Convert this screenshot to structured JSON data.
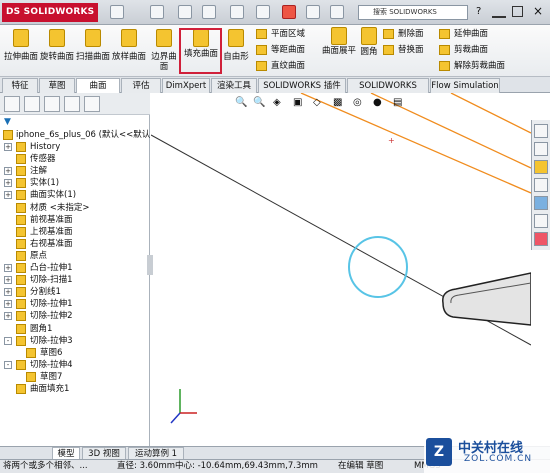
{
  "app": {
    "logo": "DS SOLIDWORKS",
    "search_placeholder": "搜索 SOLIDWORKS"
  },
  "ribbon": {
    "big": [
      "拉伸曲面",
      "旋转曲面",
      "扫描曲面",
      "放样曲面",
      "边界曲面",
      "填充曲面",
      "自由形"
    ],
    "col1": [
      "平面区域",
      "等距曲面",
      "直纹曲面"
    ],
    "mid": [
      "曲面展平",
      "圆角"
    ],
    "col2": [
      "删除面",
      "替换面"
    ],
    "col3": [
      "延伸曲面",
      "剪裁曲面",
      "解除剪裁曲面"
    ],
    "highlight": "填充曲面"
  },
  "tabs": [
    "特征",
    "草图",
    "曲面",
    "评估",
    "DimXpert",
    "渲染工具",
    "SOLIDWORKS 插件",
    "SOLIDWORKS MBD",
    "Flow Simulation"
  ],
  "active_tab": "曲面",
  "tree": {
    "filter_icon": "filter-icon",
    "root": "iphone_6s_plus_06 (默认<<默认",
    "items": [
      {
        "label": "History",
        "lvl": 1,
        "ex": "+"
      },
      {
        "label": "传感器",
        "lvl": 1,
        "ex": ""
      },
      {
        "label": "注解",
        "lvl": 1,
        "ex": "+"
      },
      {
        "label": "实体(1)",
        "lvl": 1,
        "ex": "+"
      },
      {
        "label": "曲面实体(1)",
        "lvl": 1,
        "ex": "+"
      },
      {
        "label": "材质 <未指定>",
        "lvl": 1,
        "ex": ""
      },
      {
        "label": "前视基准面",
        "lvl": 1,
        "ex": ""
      },
      {
        "label": "上视基准面",
        "lvl": 1,
        "ex": ""
      },
      {
        "label": "右视基准面",
        "lvl": 1,
        "ex": ""
      },
      {
        "label": "原点",
        "lvl": 1,
        "ex": ""
      },
      {
        "label": "凸台-拉伸1",
        "lvl": 1,
        "ex": "+"
      },
      {
        "label": "切除-扫描1",
        "lvl": 1,
        "ex": "+"
      },
      {
        "label": "分割线1",
        "lvl": 1,
        "ex": "+"
      },
      {
        "label": "切除-拉伸1",
        "lvl": 1,
        "ex": "+"
      },
      {
        "label": "切除-拉伸2",
        "lvl": 1,
        "ex": "+"
      },
      {
        "label": "圆角1",
        "lvl": 1,
        "ex": ""
      },
      {
        "label": "切除-拉伸3",
        "lvl": 1,
        "ex": "-"
      },
      {
        "label": "草图6",
        "lvl": 2,
        "ex": ""
      },
      {
        "label": "切除-拉伸4",
        "lvl": 1,
        "ex": "-"
      },
      {
        "label": "草图7",
        "lvl": 2,
        "ex": ""
      },
      {
        "label": "曲面填充1",
        "lvl": 1,
        "ex": ""
      }
    ]
  },
  "bottom_tabs": [
    "模型",
    "3D 视图",
    "运动算例 1"
  ],
  "status": {
    "left": "将两个或多个相邻、...",
    "radius": "直径: 3.60mm",
    "center": "中心: -10.64mm,69.43mm,7.3mm",
    "mode": "在编辑 草图",
    "units": "MMGS"
  },
  "watermark": {
    "cn": "中关村在线",
    "en": "ZOL.COM.CN"
  },
  "colors": {
    "accent_red": "#d0203a",
    "edge_orange": "#f08c1e",
    "circle_cyan": "#58c4e6"
  }
}
